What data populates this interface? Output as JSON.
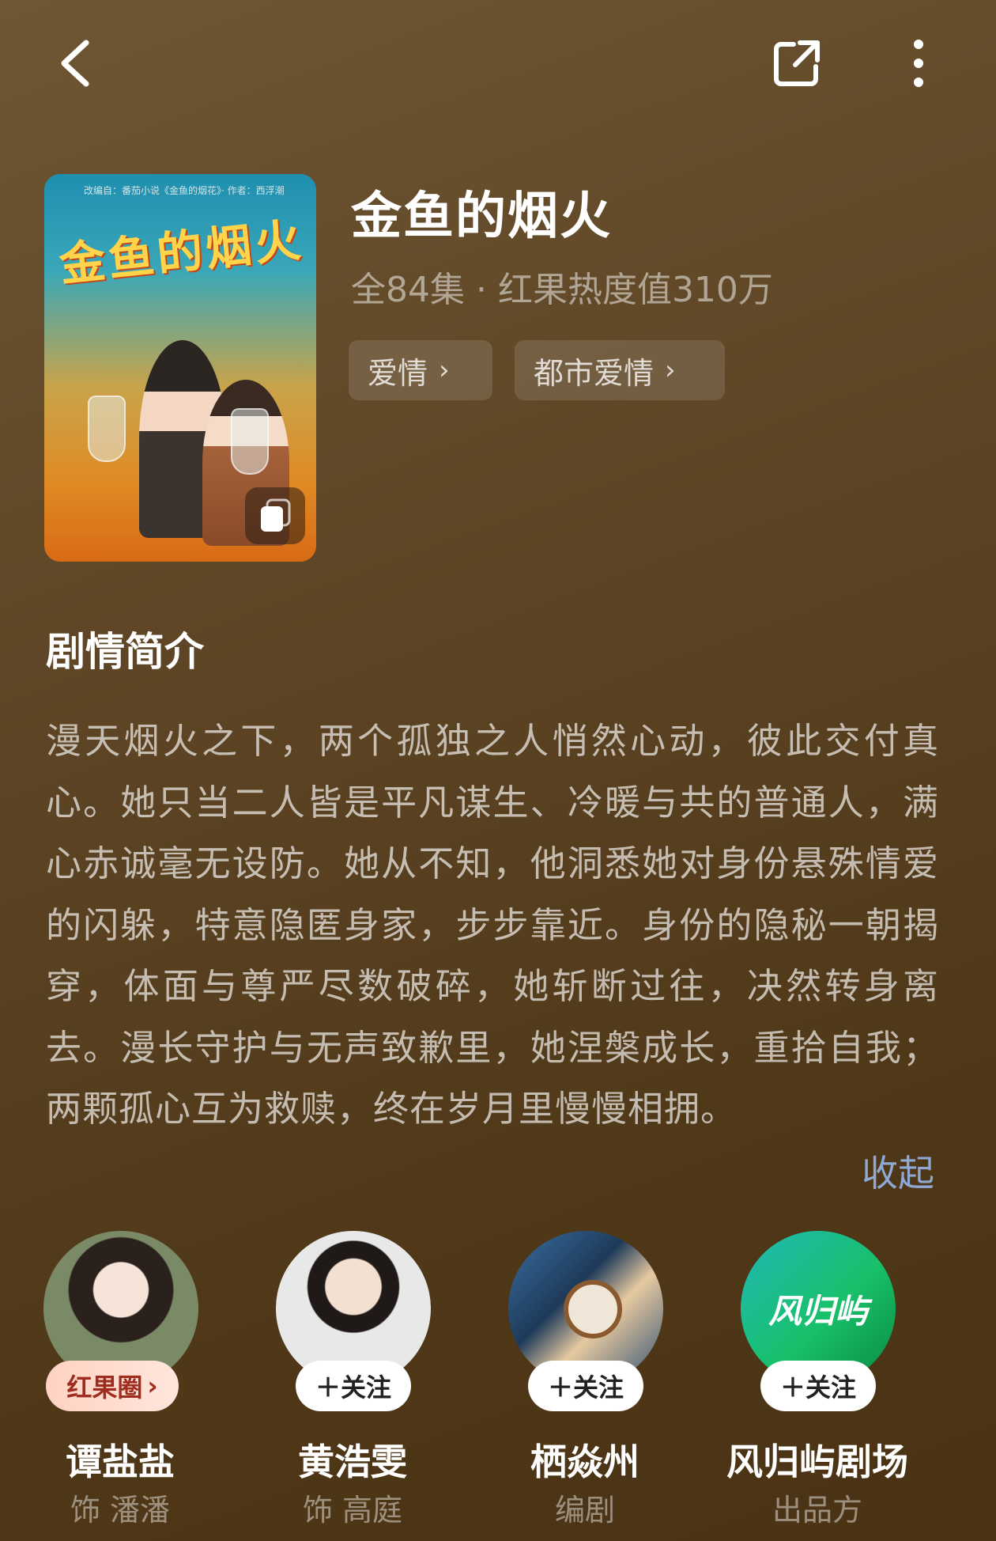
{
  "header": {
    "back_icon": "chevron-left-icon",
    "share_icon": "share-icon",
    "more_icon": "more-vertical-icon"
  },
  "drama": {
    "title": "金鱼的烟火",
    "meta": "全84集 · 红果热度值310万",
    "tags": [
      {
        "label": "爱情"
      },
      {
        "label": "都市爱情"
      }
    ],
    "poster": {
      "title_text": "金鱼的烟火",
      "subtitle": "改编自：番茄小说《金鱼的烟花》· 作者：西浮潮"
    }
  },
  "synopsis": {
    "heading": "剧情简介",
    "text": "漫天烟火之下，两个孤独之人悄然心动，彼此交付真心。她只当二人皆是平凡谋生、冷暖与共的普通人，满心赤诚毫无设防。她从不知，他洞悉她对身份悬殊情爱的闪躲，特意隐匿身家，步步靠近。身份的隐秘一朝揭穿，体面与尊严尽数破碎，她斩断过往，决然转身离去。漫长守护与无声致歉里，她涅槃成长，重拾自我；两颗孤心互为救赎，终在岁月里慢慢相拥。",
    "collapse_label": "收起"
  },
  "cast": [
    {
      "name": "谭盐盐",
      "role": "饰 潘潘",
      "action": "红果圈",
      "action_icon": "chevron-right-icon"
    },
    {
      "name": "黄浩雯",
      "role": "饰 高庭",
      "action": "＋关注"
    },
    {
      "name": "栖焱州",
      "role": "编剧",
      "action": "＋关注"
    },
    {
      "name": "风归屿剧场",
      "role": "出品方",
      "action": "＋关注",
      "logo_text": "风归屿"
    }
  ],
  "colors": {
    "background": "#5c4424",
    "accent_link": "#8fa9d4",
    "circle_pill_text": "#9e2d1f"
  }
}
